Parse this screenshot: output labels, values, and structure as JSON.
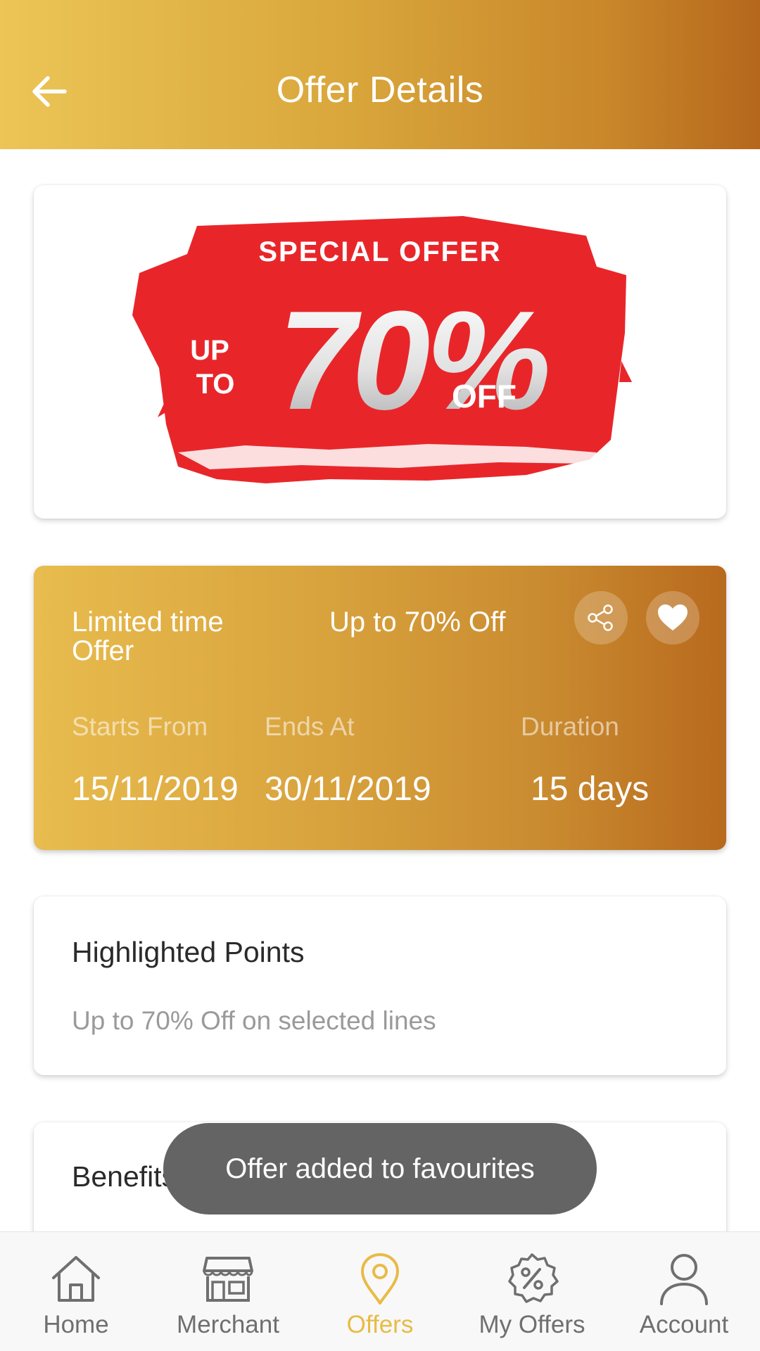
{
  "header": {
    "title": "Offer Details",
    "back_icon": "arrow-left-icon"
  },
  "banner": {
    "top_text": "SPECIAL OFFER",
    "up": "UP",
    "to": "TO",
    "big": "70%",
    "off": "OFF",
    "colors": {
      "red": "#e8262a",
      "silver": "#d8d8d8"
    }
  },
  "details": {
    "offer_type": "Limited time Offer",
    "headline": "Up to 70% Off",
    "share_icon": "share-icon",
    "favorite_icon": "heart-icon",
    "starts_label": "Starts From",
    "starts_value": "15/11/2019",
    "ends_label": "Ends At",
    "ends_value": "30/11/2019",
    "duration_label": "Duration",
    "duration_value": "15 days"
  },
  "highlights": {
    "title": "Highlighted Points",
    "text": "Up to 70% Off on selected lines"
  },
  "benefits": {
    "title": "Benefits"
  },
  "toast": {
    "message": "Offer added to favourites"
  },
  "nav": {
    "items": [
      {
        "label": "Home",
        "icon": "home-icon",
        "active": false
      },
      {
        "label": "Merchant",
        "icon": "store-icon",
        "active": false
      },
      {
        "label": "Offers",
        "icon": "location-pin-icon",
        "active": true
      },
      {
        "label": "My Offers",
        "icon": "percent-badge-icon",
        "active": false
      },
      {
        "label": "Account",
        "icon": "person-icon",
        "active": false
      }
    ]
  },
  "colors": {
    "gold_start": "#ecc556",
    "gold_end": "#b5671c",
    "active_nav": "#e8bb45",
    "inactive_nav": "#6f6f6f"
  }
}
